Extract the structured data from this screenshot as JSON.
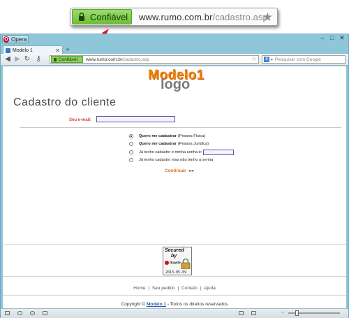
{
  "callout": {
    "secure_label": "Confiável",
    "url_domain": "www.rumo.com.br",
    "url_path": "/cadastro.asp"
  },
  "browser": {
    "app_menu": "Opera",
    "tab_title": "Modelo 1",
    "new_tab": "+",
    "secure_label": "Confiável",
    "url_domain": "www.rumo.com.br",
    "url_path": "/cadastro.asp",
    "search_placeholder": "Pesquisar com Google",
    "search_engine_badge": "8"
  },
  "logo": {
    "line1": "Modelo1",
    "line2": "logo"
  },
  "page": {
    "title": "Cadastro do cliente",
    "email_label": "Seu e-mail:",
    "options": [
      {
        "bold": "Quero me cadastrar",
        "rest": "(Pessoa Física)",
        "selected": true
      },
      {
        "bold": "Quero me cadastrar",
        "rest": "(Pessoa Jurídica)",
        "selected": false
      },
      {
        "bold": "",
        "rest": "Já tenho cadastro e minha senha é:",
        "selected": false
      },
      {
        "bold": "",
        "rest": "Já tenho cadastro mas não tenho a senha",
        "selected": false
      }
    ],
    "continue_label": "Continuar",
    "continue_arrow": "»»"
  },
  "seal": {
    "line1": "Secured",
    "line2": "by",
    "brand": "thawte",
    "date": "2013-05-09"
  },
  "footer": {
    "links": [
      "Home",
      "Seu pedido",
      "Contato",
      "Ajuda"
    ],
    "separator": "|",
    "copyright_prefix": "Copyright ©",
    "copyright_link": "Modelo 1",
    "copyright_suffix": "- Todos os direitos reservados"
  },
  "colors": {
    "secure_green": "#8ed05e",
    "accent_orange": "#f0820c",
    "error_red": "#e03a3a",
    "link_blue": "#2a5aa8",
    "window_frame": "#8ec6da"
  }
}
